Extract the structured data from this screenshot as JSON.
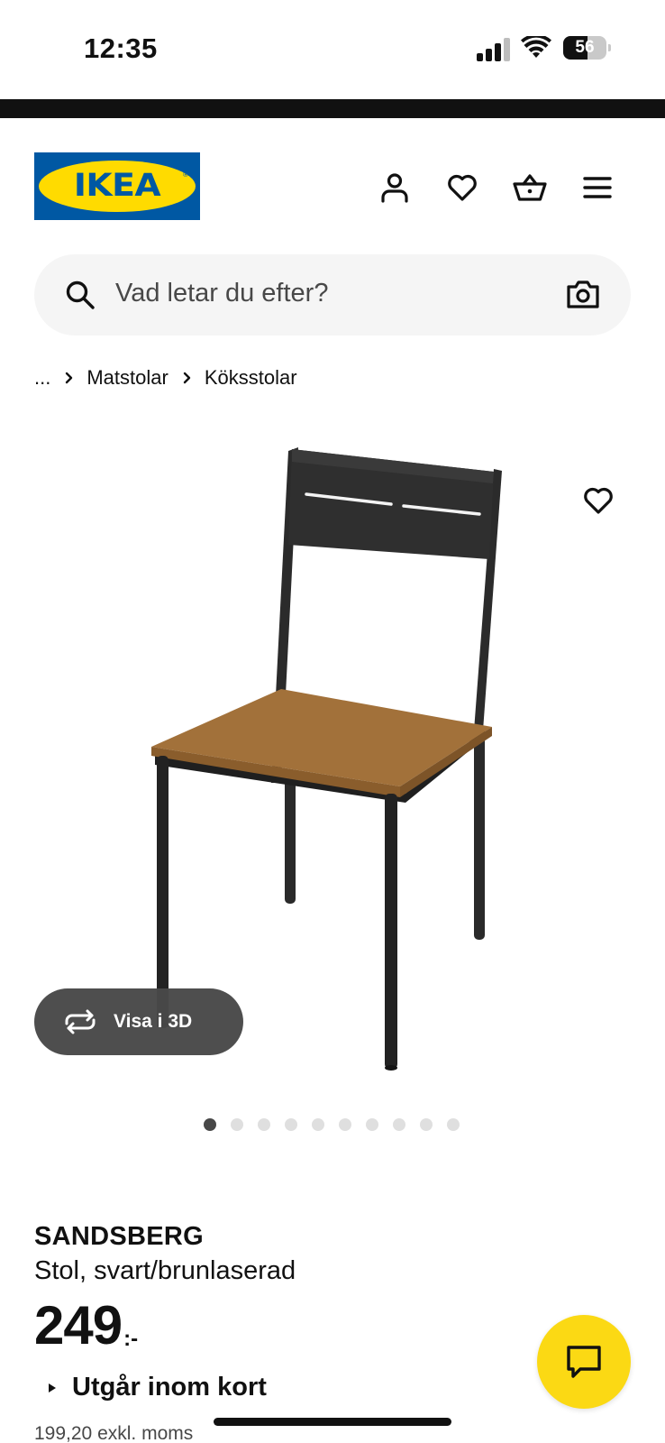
{
  "status_bar": {
    "time": "12:35",
    "battery_level": "56",
    "battery_percent": 56
  },
  "header": {
    "logo_text": "IKEA",
    "logo_registered": "®",
    "brand_colors": {
      "blue": "#0058a3",
      "yellow": "#ffdb00"
    },
    "icons": [
      "user-icon",
      "heart-icon",
      "basket-icon",
      "menu-icon"
    ]
  },
  "search": {
    "placeholder": "Vad letar du efter?",
    "icon": "search-icon",
    "visual_search_icon": "camera-icon"
  },
  "breadcrumb": {
    "ellipsis": "...",
    "items": [
      "Matstolar",
      "Köksstolar"
    ]
  },
  "gallery": {
    "view_3d_label": "Visa i 3D",
    "image_count": 10,
    "active_index": 0
  },
  "product": {
    "name": "SANDSBERG",
    "description": "Stol, svart/brunlaserad",
    "price_integer": "249",
    "price_suffix": ":-",
    "availability": "Utgår inom kort",
    "price_excl_vat": "199,20 exkl. moms"
  },
  "chat": {
    "icon": "chat-icon",
    "color": "#fbd914"
  }
}
